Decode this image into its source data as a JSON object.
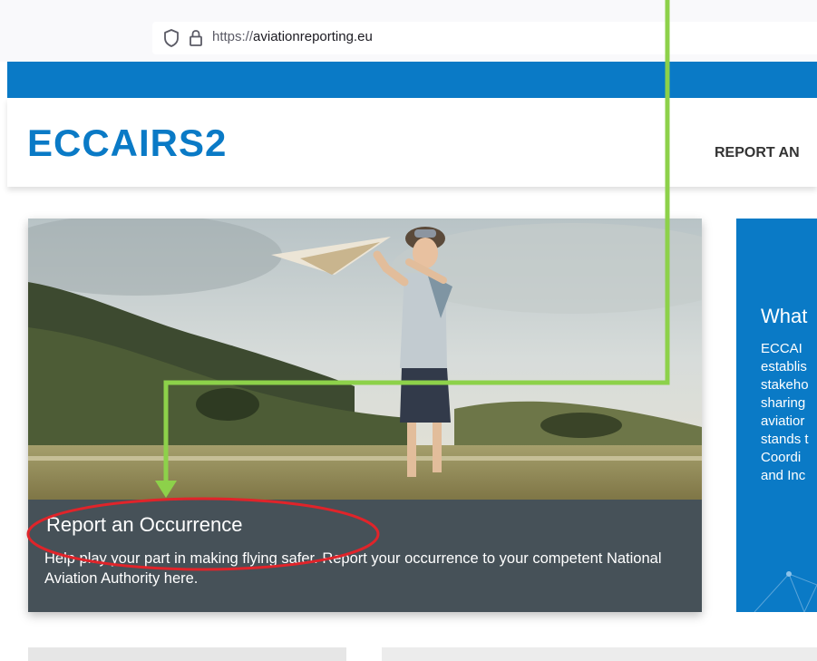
{
  "browser": {
    "url_scheme": "https://",
    "url_host": "aviationreporting.eu"
  },
  "site": {
    "logo_text": "ECCAIRS2",
    "nav_item": "REPORT AN"
  },
  "main_card": {
    "title": "Report an Occurrence",
    "text": "Help play your part in making flying safer. Report your occurrence to your competent National Aviation Authority here."
  },
  "side_card": {
    "title": "What",
    "lines": [
      "ECCAI",
      "establis",
      "stakeho",
      "sharing",
      "aviatior",
      "stands t",
      "Coordi",
      "and Inc"
    ]
  },
  "colors": {
    "brand_blue": "#0a7ac6",
    "caption_bg": "#465158",
    "annotation_arrow": "#8dd14a",
    "annotation_ellipse": "#e0242a"
  }
}
